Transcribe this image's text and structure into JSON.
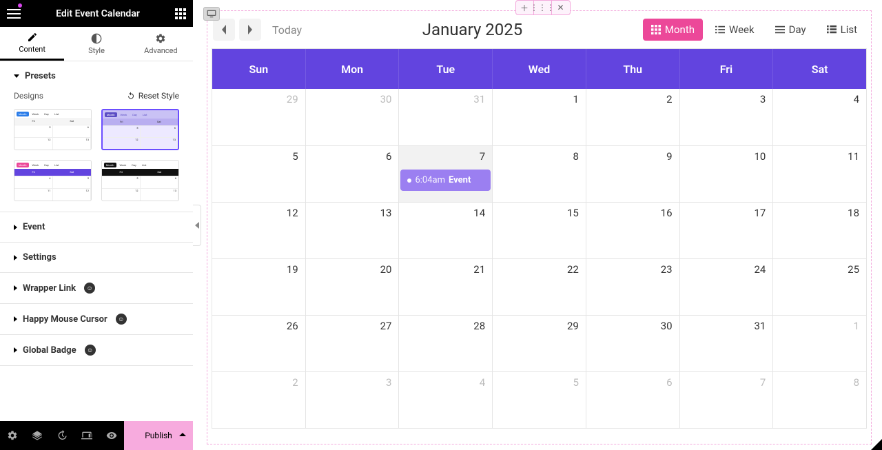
{
  "sidebar": {
    "title": "Edit Event Calendar",
    "tabs": {
      "content": "Content",
      "style": "Style",
      "advanced": "Advanced"
    },
    "presets": {
      "title": "Presets",
      "designs_label": "Designs",
      "reset_label": "Reset Style"
    },
    "sections": {
      "event": "Event",
      "settings": "Settings",
      "wrapper_link": "Wrapper Link",
      "happy_mouse": "Happy Mouse Cursor",
      "global_badge": "Global Badge"
    },
    "footer": {
      "publish": "Publish"
    }
  },
  "calendar": {
    "today_label": "Today",
    "title": "January 2025",
    "views": {
      "month": "Month",
      "week": "Week",
      "day": "Day",
      "list": "List"
    },
    "days": [
      "Sun",
      "Mon",
      "Tue",
      "Wed",
      "Thu",
      "Fri",
      "Sat"
    ],
    "weeks": [
      [
        {
          "d": "29",
          "o": true
        },
        {
          "d": "30",
          "o": true
        },
        {
          "d": "31",
          "o": true
        },
        {
          "d": "1"
        },
        {
          "d": "2"
        },
        {
          "d": "3"
        },
        {
          "d": "4"
        }
      ],
      [
        {
          "d": "5"
        },
        {
          "d": "6"
        },
        {
          "d": "7",
          "today": true,
          "event": {
            "time": "6:04am",
            "title": "Event"
          }
        },
        {
          "d": "8"
        },
        {
          "d": "9"
        },
        {
          "d": "10"
        },
        {
          "d": "11"
        }
      ],
      [
        {
          "d": "12"
        },
        {
          "d": "13"
        },
        {
          "d": "14"
        },
        {
          "d": "15"
        },
        {
          "d": "16"
        },
        {
          "d": "17"
        },
        {
          "d": "18"
        }
      ],
      [
        {
          "d": "19"
        },
        {
          "d": "20"
        },
        {
          "d": "21"
        },
        {
          "d": "22"
        },
        {
          "d": "23"
        },
        {
          "d": "24"
        },
        {
          "d": "25"
        }
      ],
      [
        {
          "d": "26"
        },
        {
          "d": "27"
        },
        {
          "d": "28"
        },
        {
          "d": "29"
        },
        {
          "d": "30"
        },
        {
          "d": "31"
        },
        {
          "d": "1",
          "o": true
        }
      ],
      [
        {
          "d": "2",
          "o": true
        },
        {
          "d": "3",
          "o": true
        },
        {
          "d": "4",
          "o": true
        },
        {
          "d": "5",
          "o": true
        },
        {
          "d": "6",
          "o": true
        },
        {
          "d": "7",
          "o": true
        },
        {
          "d": "8",
          "o": true
        }
      ]
    ]
  },
  "colors": {
    "accent_purple": "#6244df",
    "accent_pink": "#ec4899",
    "event_bg": "#9b7ff1"
  }
}
